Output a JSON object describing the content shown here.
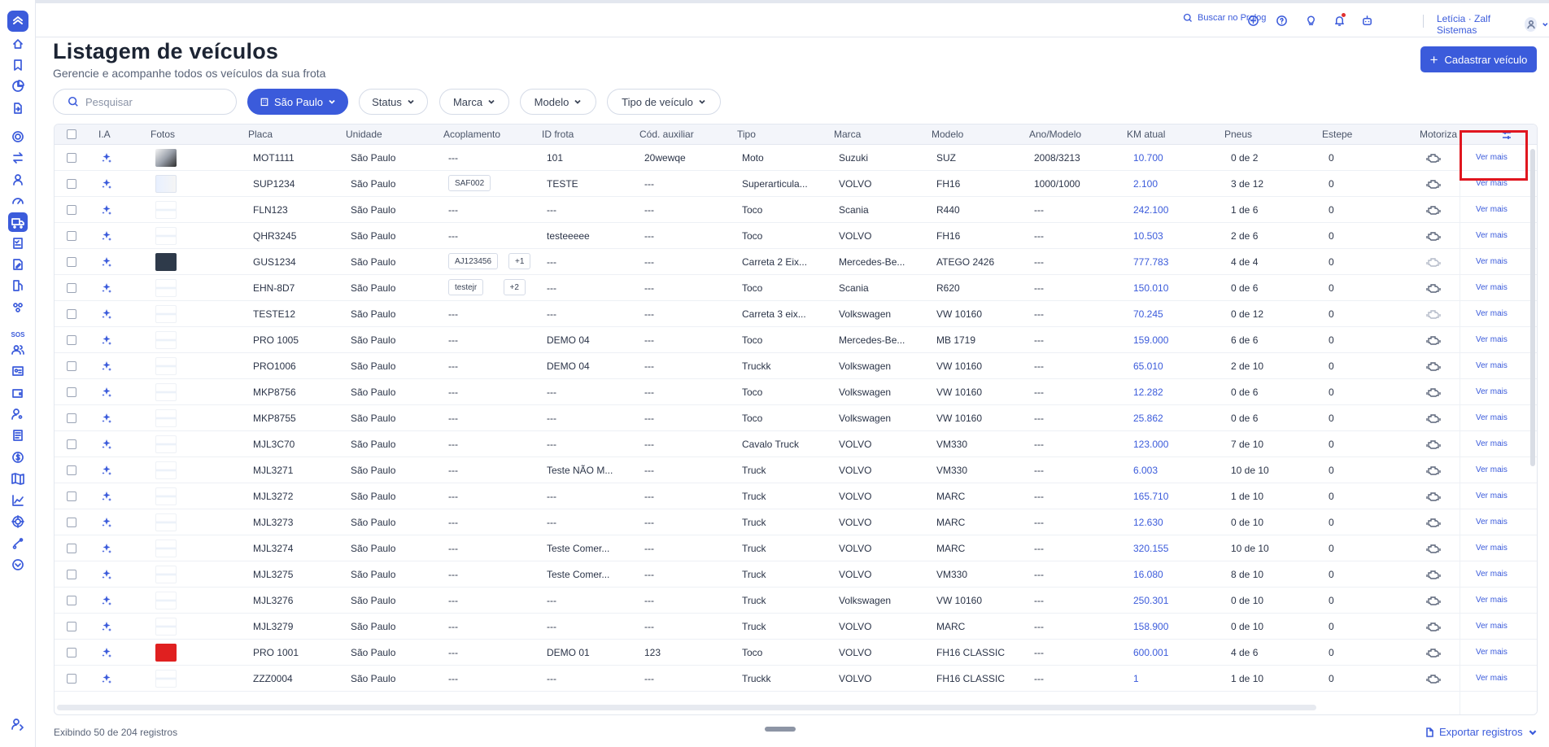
{
  "topbar": {
    "search_label": "Buscar no Prolog",
    "user_label": "Letícia · Zalf Sistemas"
  },
  "header": {
    "title": "Listagem de veículos",
    "subtitle": "Gerencie e acompanhe todos os veículos da sua frota",
    "add_button": "Cadastrar veículo"
  },
  "filters": {
    "search_placeholder": "Pesquisar",
    "unit": "São Paulo",
    "status": "Status",
    "brand": "Marca",
    "model": "Modelo",
    "vehicle_type": "Tipo de veículo"
  },
  "sidebar": {
    "sos_label": "SOS"
  },
  "table": {
    "columns": [
      "I.A",
      "Fotos",
      "Placa",
      "Unidade",
      "Acoplamento",
      "ID frota",
      "Cód. auxiliar",
      "Tipo",
      "Marca",
      "Modelo",
      "Ano/Modelo",
      "KM atual",
      "Pneus",
      "Estepe",
      "Motoriza"
    ],
    "action_label": "Ver mais",
    "rows": [
      {
        "placa": "MOT1111",
        "unidade": "São Paulo",
        "acoplamento": "---",
        "badges": [],
        "id_frota": "101",
        "cod": "20wewqe",
        "tipo": "Moto",
        "marca": "Suzuki",
        "modelo": "SUZ",
        "ano": "2008/3213",
        "km": "10.700",
        "pneus": "0 de 2",
        "estepe": "0",
        "photo": "moto",
        "engine_off": false
      },
      {
        "placa": "SUP1234",
        "unidade": "São Paulo",
        "acoplamento": "",
        "badges": [
          "SAF002"
        ],
        "id_frota": "TESTE",
        "cod": "---",
        "tipo": "Superarticula...",
        "marca": "VOLVO",
        "modelo": "FH16",
        "ano": "1000/1000",
        "km": "2.100",
        "pneus": "3 de 12",
        "estepe": "0",
        "photo": "sup",
        "engine_off": false
      },
      {
        "placa": "FLN123",
        "unidade": "São Paulo",
        "acoplamento": "---",
        "badges": [],
        "id_frota": "---",
        "cod": "---",
        "tipo": "Toco",
        "marca": "Scania",
        "modelo": "R440",
        "ano": "---",
        "km": "242.100",
        "pneus": "1 de 6",
        "estepe": "0",
        "photo": "blank",
        "engine_off": false
      },
      {
        "placa": "QHR3245",
        "unidade": "São Paulo",
        "acoplamento": "---",
        "badges": [],
        "id_frota": "testeeeee",
        "cod": "---",
        "tipo": "Toco",
        "marca": "VOLVO",
        "modelo": "FH16",
        "ano": "---",
        "km": "10.503",
        "pneus": "2 de 6",
        "estepe": "0",
        "photo": "blank",
        "engine_off": false
      },
      {
        "placa": "GUS1234",
        "unidade": "São Paulo",
        "acoplamento": "",
        "badges": [
          "AJ123456",
          "+1"
        ],
        "id_frota": "---",
        "cod": "---",
        "tipo": "Carreta 2 Eix...",
        "marca": "Mercedes-Be...",
        "modelo": "ATEGO 2426",
        "ano": "---",
        "km": "777.783",
        "pneus": "4 de 4",
        "estepe": "0",
        "photo": "dark",
        "engine_off": true
      },
      {
        "placa": "EHN-8D7",
        "unidade": "São Paulo",
        "acoplamento": "",
        "badges": [
          "testejr",
          "+2"
        ],
        "id_frota": "---",
        "cod": "---",
        "tipo": "Toco",
        "marca": "Scania",
        "modelo": "R620",
        "ano": "---",
        "km": "150.010",
        "pneus": "0 de 6",
        "estepe": "0",
        "photo": "blank",
        "engine_off": false
      },
      {
        "placa": "TESTE12",
        "unidade": "São Paulo",
        "acoplamento": "---",
        "badges": [],
        "id_frota": "---",
        "cod": "---",
        "tipo": "Carreta 3 eix...",
        "marca": "Volkswagen",
        "modelo": "VW 10160",
        "ano": "---",
        "km": "70.245",
        "pneus": "0 de 12",
        "estepe": "0",
        "photo": "blank",
        "engine_off": true
      },
      {
        "placa": "PRO 1005",
        "unidade": "São Paulo",
        "acoplamento": "---",
        "badges": [],
        "id_frota": "DEMO 04",
        "cod": "---",
        "tipo": "Toco",
        "marca": "Mercedes-Be...",
        "modelo": "MB 1719",
        "ano": "---",
        "km": "159.000",
        "pneus": "6 de 6",
        "estepe": "0",
        "photo": "blank",
        "engine_off": false
      },
      {
        "placa": "PRO1006",
        "unidade": "São Paulo",
        "acoplamento": "---",
        "badges": [],
        "id_frota": "DEMO 04",
        "cod": "---",
        "tipo": "Truckk",
        "marca": "Volkswagen",
        "modelo": "VW 10160",
        "ano": "---",
        "km": "65.010",
        "pneus": "2 de 10",
        "estepe": "0",
        "photo": "blank",
        "engine_off": false
      },
      {
        "placa": "MKP8756",
        "unidade": "São Paulo",
        "acoplamento": "---",
        "badges": [],
        "id_frota": "---",
        "cod": "---",
        "tipo": "Toco",
        "marca": "Volkswagen",
        "modelo": "VW 10160",
        "ano": "---",
        "km": "12.282",
        "pneus": "0 de 6",
        "estepe": "0",
        "photo": "blank",
        "engine_off": false
      },
      {
        "placa": "MKP8755",
        "unidade": "São Paulo",
        "acoplamento": "---",
        "badges": [],
        "id_frota": "---",
        "cod": "---",
        "tipo": "Toco",
        "marca": "Volkswagen",
        "modelo": "VW 10160",
        "ano": "---",
        "km": "25.862",
        "pneus": "0 de 6",
        "estepe": "0",
        "photo": "blank",
        "engine_off": false
      },
      {
        "placa": "MJL3C70",
        "unidade": "São Paulo",
        "acoplamento": "---",
        "badges": [],
        "id_frota": "---",
        "cod": "---",
        "tipo": "Cavalo Truck",
        "marca": "VOLVO",
        "modelo": "VM330",
        "ano": "---",
        "km": "123.000",
        "pneus": "7 de 10",
        "estepe": "0",
        "photo": "blank",
        "engine_off": false
      },
      {
        "placa": "MJL3271",
        "unidade": "São Paulo",
        "acoplamento": "---",
        "badges": [],
        "id_frota": "Teste NÃO M...",
        "cod": "---",
        "tipo": "Truck",
        "marca": "VOLVO",
        "modelo": "VM330",
        "ano": "---",
        "km": "6.003",
        "pneus": "10 de 10",
        "estepe": "0",
        "photo": "blank",
        "engine_off": false
      },
      {
        "placa": "MJL3272",
        "unidade": "São Paulo",
        "acoplamento": "---",
        "badges": [],
        "id_frota": "---",
        "cod": "---",
        "tipo": "Truck",
        "marca": "VOLVO",
        "modelo": "MARC",
        "ano": "---",
        "km": "165.710",
        "pneus": "1 de 10",
        "estepe": "0",
        "photo": "blank",
        "engine_off": false
      },
      {
        "placa": "MJL3273",
        "unidade": "São Paulo",
        "acoplamento": "---",
        "badges": [],
        "id_frota": "---",
        "cod": "---",
        "tipo": "Truck",
        "marca": "VOLVO",
        "modelo": "MARC",
        "ano": "---",
        "km": "12.630",
        "pneus": "0 de 10",
        "estepe": "0",
        "photo": "blank",
        "engine_off": false
      },
      {
        "placa": "MJL3274",
        "unidade": "São Paulo",
        "acoplamento": "---",
        "badges": [],
        "id_frota": "Teste Comer...",
        "cod": "---",
        "tipo": "Truck",
        "marca": "VOLVO",
        "modelo": "MARC",
        "ano": "---",
        "km": "320.155",
        "pneus": "10 de 10",
        "estepe": "0",
        "photo": "blank",
        "engine_off": false
      },
      {
        "placa": "MJL3275",
        "unidade": "São Paulo",
        "acoplamento": "---",
        "badges": [],
        "id_frota": "Teste Comer...",
        "cod": "---",
        "tipo": "Truck",
        "marca": "VOLVO",
        "modelo": "VM330",
        "ano": "---",
        "km": "16.080",
        "pneus": "8 de 10",
        "estepe": "0",
        "photo": "blank",
        "engine_off": false
      },
      {
        "placa": "MJL3276",
        "unidade": "São Paulo",
        "acoplamento": "---",
        "badges": [],
        "id_frota": "---",
        "cod": "---",
        "tipo": "Truck",
        "marca": "Volkswagen",
        "modelo": "VW 10160",
        "ano": "---",
        "km": "250.301",
        "pneus": "0 de 10",
        "estepe": "0",
        "photo": "blank",
        "engine_off": false
      },
      {
        "placa": "MJL3279",
        "unidade": "São Paulo",
        "acoplamento": "---",
        "badges": [],
        "id_frota": "---",
        "cod": "---",
        "tipo": "Truck",
        "marca": "VOLVO",
        "modelo": "MARC",
        "ano": "---",
        "km": "158.900",
        "pneus": "0 de 10",
        "estepe": "0",
        "photo": "blank",
        "engine_off": false
      },
      {
        "placa": "PRO 1001",
        "unidade": "São Paulo",
        "acoplamento": "---",
        "badges": [],
        "id_frota": "DEMO 01",
        "cod": "123",
        "tipo": "Toco",
        "marca": "VOLVO",
        "modelo": "FH16 CLASSIC",
        "ano": "---",
        "km": "600.001",
        "pneus": "4 de 6",
        "estepe": "0",
        "photo": "red",
        "engine_off": false
      },
      {
        "placa": "ZZZ0004",
        "unidade": "São Paulo",
        "acoplamento": "---",
        "badges": [],
        "id_frota": "---",
        "cod": "---",
        "tipo": "Truckk",
        "marca": "VOLVO",
        "modelo": "FH16 CLASSIC",
        "ano": "---",
        "km": "1",
        "pneus": "1 de 10",
        "estepe": "0",
        "photo": "blank",
        "engine_off": false
      }
    ]
  },
  "footer": {
    "count_label": "Exibindo 50 de 204 registros",
    "export_label": "Exportar registros"
  }
}
